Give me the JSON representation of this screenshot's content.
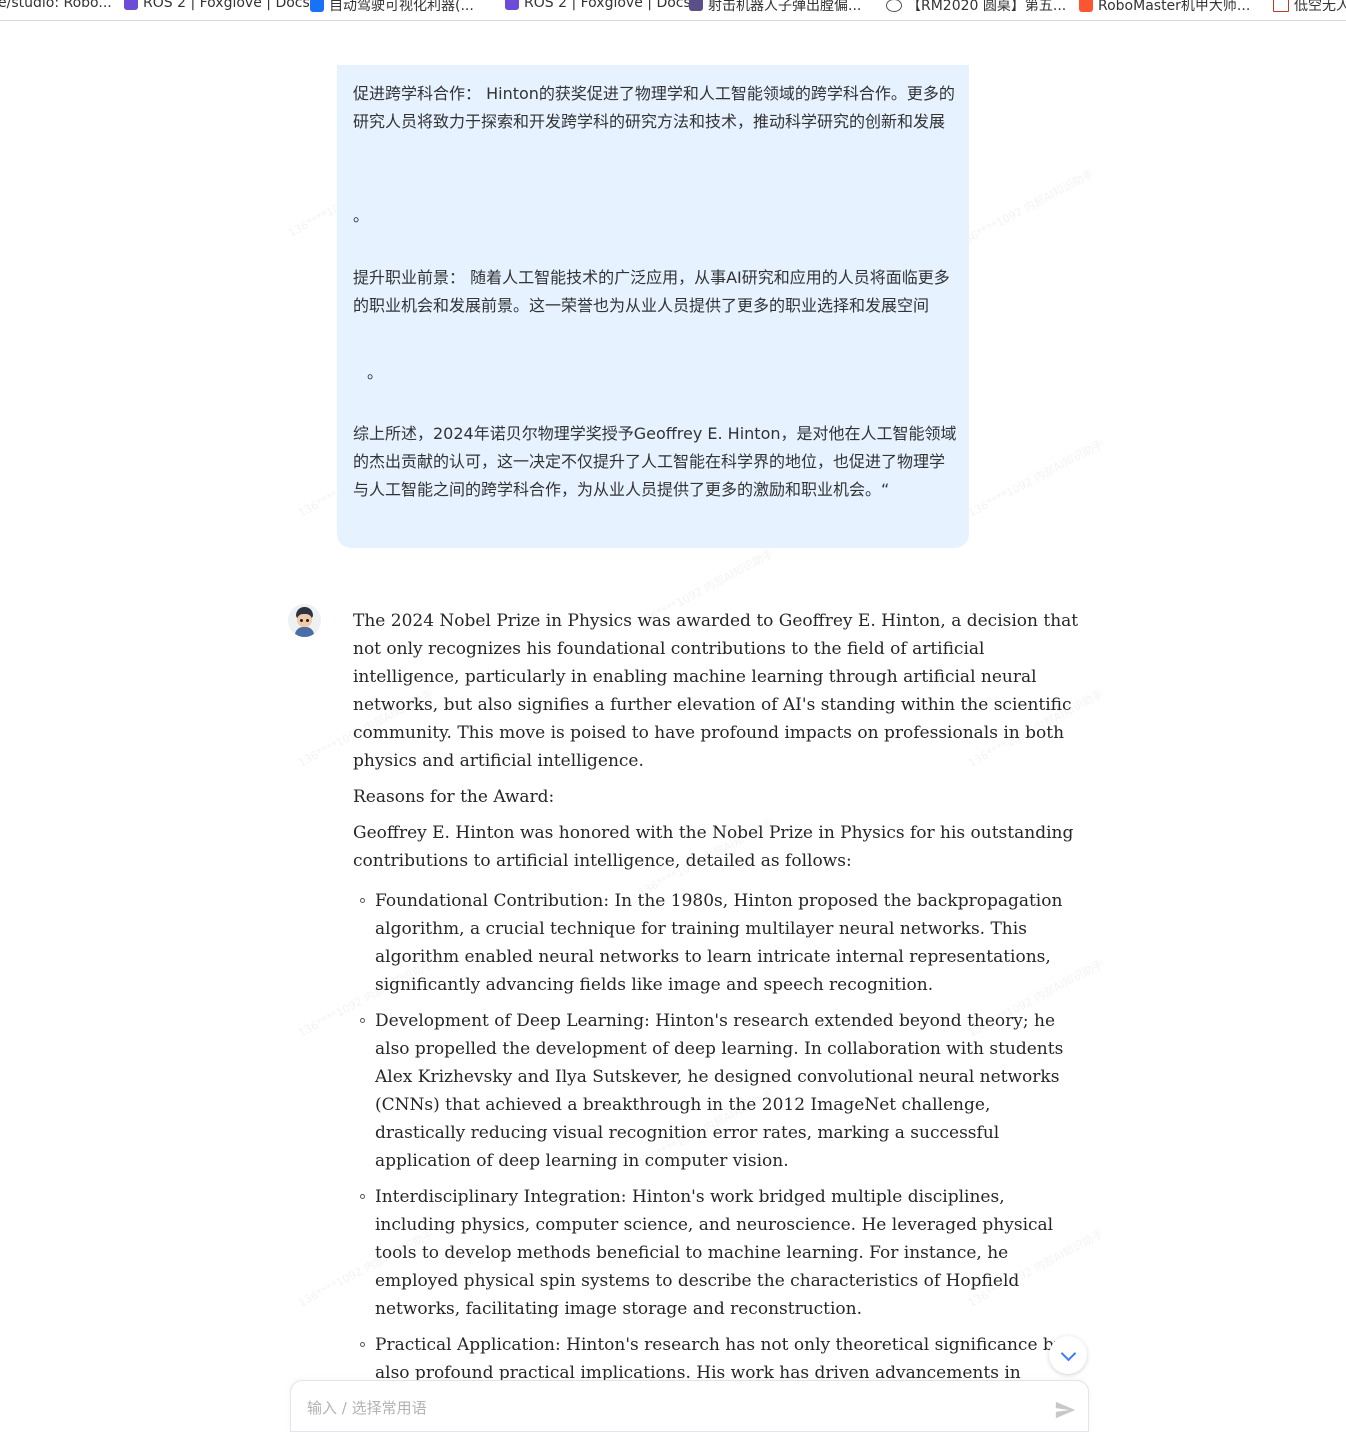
{
  "bookmarks": [
    {
      "label": "e/studio: Robo...",
      "icon": "studio-icon",
      "color": "#ffffff"
    },
    {
      "label": "ROS 2 | Foxglove | Docs",
      "icon": "foxglove-icon",
      "color": "#6c4bd8"
    },
    {
      "label": "自动驾驶可视化利器(...",
      "icon": "zhihu-icon",
      "color": "#1772f6"
    },
    {
      "label": "ROS 2 | Foxglove | Docs",
      "icon": "foxglove-icon",
      "color": "#6c4bd8"
    },
    {
      "label": "射击机器人子弹出膛偏...",
      "icon": "folder-icon",
      "color": "#5b4f8a"
    },
    {
      "label": "【RM2020 圆桌】第五...",
      "icon": "globe-icon",
      "color": "#555555"
    },
    {
      "label": "RoboMaster机甲大师...",
      "icon": "csdn-icon",
      "color": "#fc5531"
    },
    {
      "label": "低空无人",
      "icon": "doc-icon",
      "color": "#c0392b"
    }
  ],
  "user_message": {
    "p1": "促进跨学科合作： Hinton的获奖促进了物理学和人工智能领域的跨学科合作。更多的研究人员将致力于探索和开发跨学科的研究方法和技术，推动科学研究的创新和发展",
    "p2": "。",
    "p3": "提升职业前景： 随着人工智能技术的广泛应用，从事AI研究和应用的人员将面临更多的职业机会和发展前景。这一荣誉也为从业人员提供了更多的职业选择和发展空间",
    "p4": "。",
    "p5": "综上所述，2024年诺贝尔物理学奖授予Geoffrey E. Hinton，是对他在人工智能领域的杰出贡献的认可，这一决定不仅提升了人工智能在科学界的地位，也促进了物理学与人工智能之间的跨学科合作，为从业人员提供了更多的激励和职业机会。“"
  },
  "assistant_message": {
    "intro": "The 2024 Nobel Prize in Physics was awarded to Geoffrey E. Hinton, a decision that not only recognizes his foundational contributions to the field of artificial intelligence, particularly in enabling machine learning through artificial neural networks, but also signifies a further elevation of AI's standing within the scientific community. This move is poised to have profound impacts on professionals in both physics and artificial intelligence.",
    "reasons_heading": "Reasons for the Award:",
    "reasons_intro": "Geoffrey E. Hinton was honored with the Nobel Prize in Physics for his outstanding contributions to artificial intelligence, detailed as follows:",
    "bullets": [
      "Foundational Contribution: In the 1980s, Hinton proposed the backpropagation algorithm, a crucial technique for training multilayer neural networks. This algorithm enabled neural networks to learn intricate internal representations, significantly advancing fields like image and speech recognition.",
      "Development of Deep Learning: Hinton's research extended beyond theory; he also propelled the development of deep learning. In collaboration with students Alex Krizhevsky and Ilya Sutskever, he designed convolutional neural networks (CNNs) that achieved a breakthrough in the 2012 ImageNet challenge, drastically reducing visual recognition error rates, marking a successful application of deep learning in computer vision.",
      "Interdisciplinary Integration: Hinton's work bridged multiple disciplines, including physics, computer science, and neuroscience. He leveraged physical tools to develop methods beneficial to machine learning. For instance, he employed physical spin systems to describe the characteristics of Hopfield networks, facilitating image storage and reconstruction.",
      "Practical Application: Hinton's research has not only theoretical significance but also profound practical implications. His work has driven advancements in speech"
    ]
  },
  "input": {
    "placeholder": "输入 / 选择常用语"
  },
  "watermark": "136****1092 内部AI知识助手",
  "colors": {
    "bubble_bg": "#e6f2ff",
    "accent": "#3b7cff",
    "send_icon": "#c8c8c8"
  }
}
